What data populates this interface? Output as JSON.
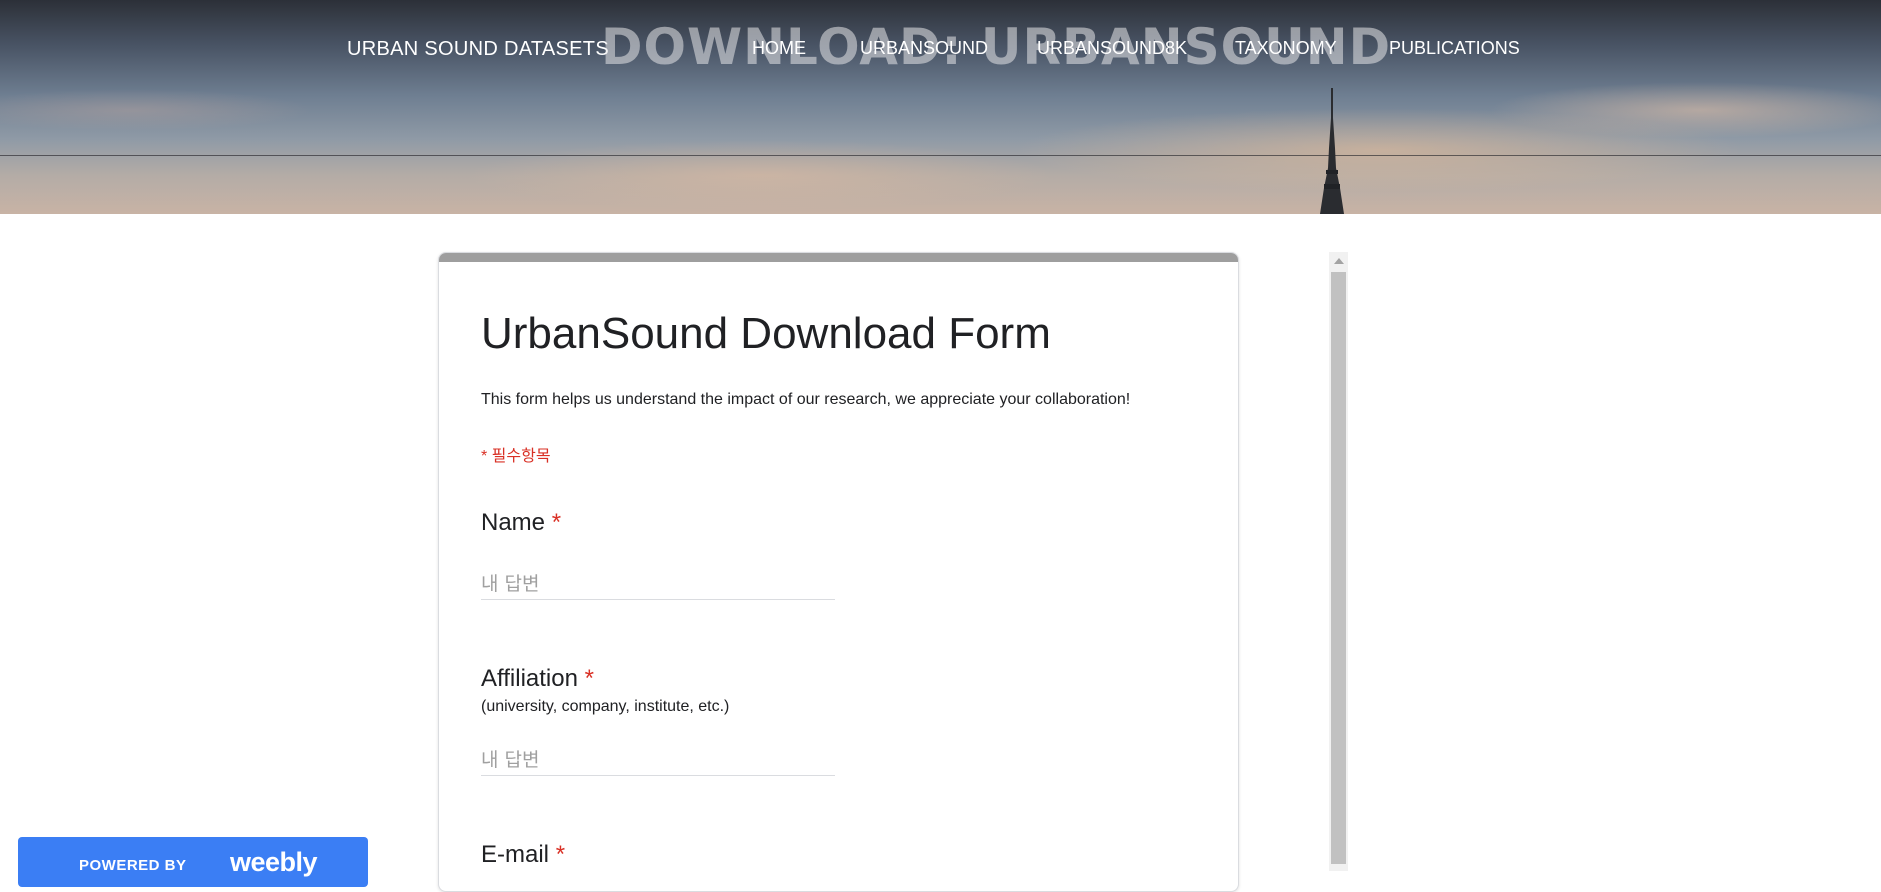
{
  "header": {
    "site_title": "URBAN SOUND DATASETS",
    "page_heading": "DOWNLOAD: URBANSOUND",
    "nav": [
      {
        "label": "HOME"
      },
      {
        "label": "URBANSOUND"
      },
      {
        "label": "URBANSOUND8K"
      },
      {
        "label": "TAXONOMY"
      },
      {
        "label": "PUBLICATIONS"
      }
    ]
  },
  "form": {
    "title": "UrbanSound Download Form",
    "description": "This form helps us understand the impact of our research, we appreciate your collaboration!",
    "required_note": "* 필수항목",
    "accent_color": "#9e9e9e",
    "required_color": "#d93025",
    "questions": [
      {
        "label": "Name",
        "required_mark": "*",
        "help": "",
        "placeholder": "내 답변",
        "value": ""
      },
      {
        "label": "Affiliation",
        "required_mark": "*",
        "help": "(university, company, institute, etc.)",
        "placeholder": "내 답변",
        "value": ""
      },
      {
        "label": "E-mail",
        "required_mark": "*"
      }
    ]
  },
  "badge": {
    "powered_text": "POWERED BY",
    "logo_text": "weebly",
    "color": "#3b7ef4"
  }
}
